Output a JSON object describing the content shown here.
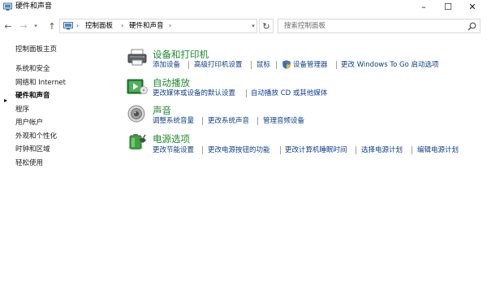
{
  "window": {
    "title": "硬件和声音",
    "minimize": "–",
    "maximize": "☐",
    "close": "✕"
  },
  "nav": {
    "back": "←",
    "forward": "→",
    "recent": "▾",
    "up": "↑",
    "breadcrumb": [
      "控制面板",
      "硬件和声音"
    ],
    "separator": "›",
    "dropdown": "▾",
    "refresh": "↻"
  },
  "search": {
    "placeholder": "搜索控制面板"
  },
  "sidebar": {
    "home": "控制面板主页",
    "items": [
      {
        "label": "系统和安全",
        "active": false
      },
      {
        "label": "网络和 Internet",
        "active": false
      },
      {
        "label": "硬件和声音",
        "active": true
      },
      {
        "label": "程序",
        "active": false
      },
      {
        "label": "用户帐户",
        "active": false
      },
      {
        "label": "外观和个性化",
        "active": false
      },
      {
        "label": "时钟和区域",
        "active": false
      },
      {
        "label": "轻松使用",
        "active": false
      }
    ],
    "active_marker": "▸"
  },
  "categories": [
    {
      "title": "设备和打印机",
      "icon": "printer-icon",
      "links": [
        "添加设备",
        "高级打印机设置",
        "鼠标",
        "设备管理器",
        "更改 Windows To Go 启动选项"
      ]
    },
    {
      "title": "自动播放",
      "icon": "autoplay-icon",
      "links": [
        "更改媒体或设备的默认设置",
        "自动播放 CD 或其他媒体"
      ]
    },
    {
      "title": "声音",
      "icon": "speaker-icon",
      "links": [
        "调整系统音量",
        "更改系统声音",
        "管理音频设备"
      ]
    },
    {
      "title": "电源选项",
      "icon": "battery-icon",
      "links": [
        "更改节能设置",
        "更改电源按钮的功能",
        "更改计算机睡眠时间",
        "选择电源计划",
        "编辑电源计划"
      ]
    }
  ],
  "colors": {
    "category_title": "#1f8a2c",
    "link": "#0f3f8c",
    "border": "#d9d9d9"
  }
}
